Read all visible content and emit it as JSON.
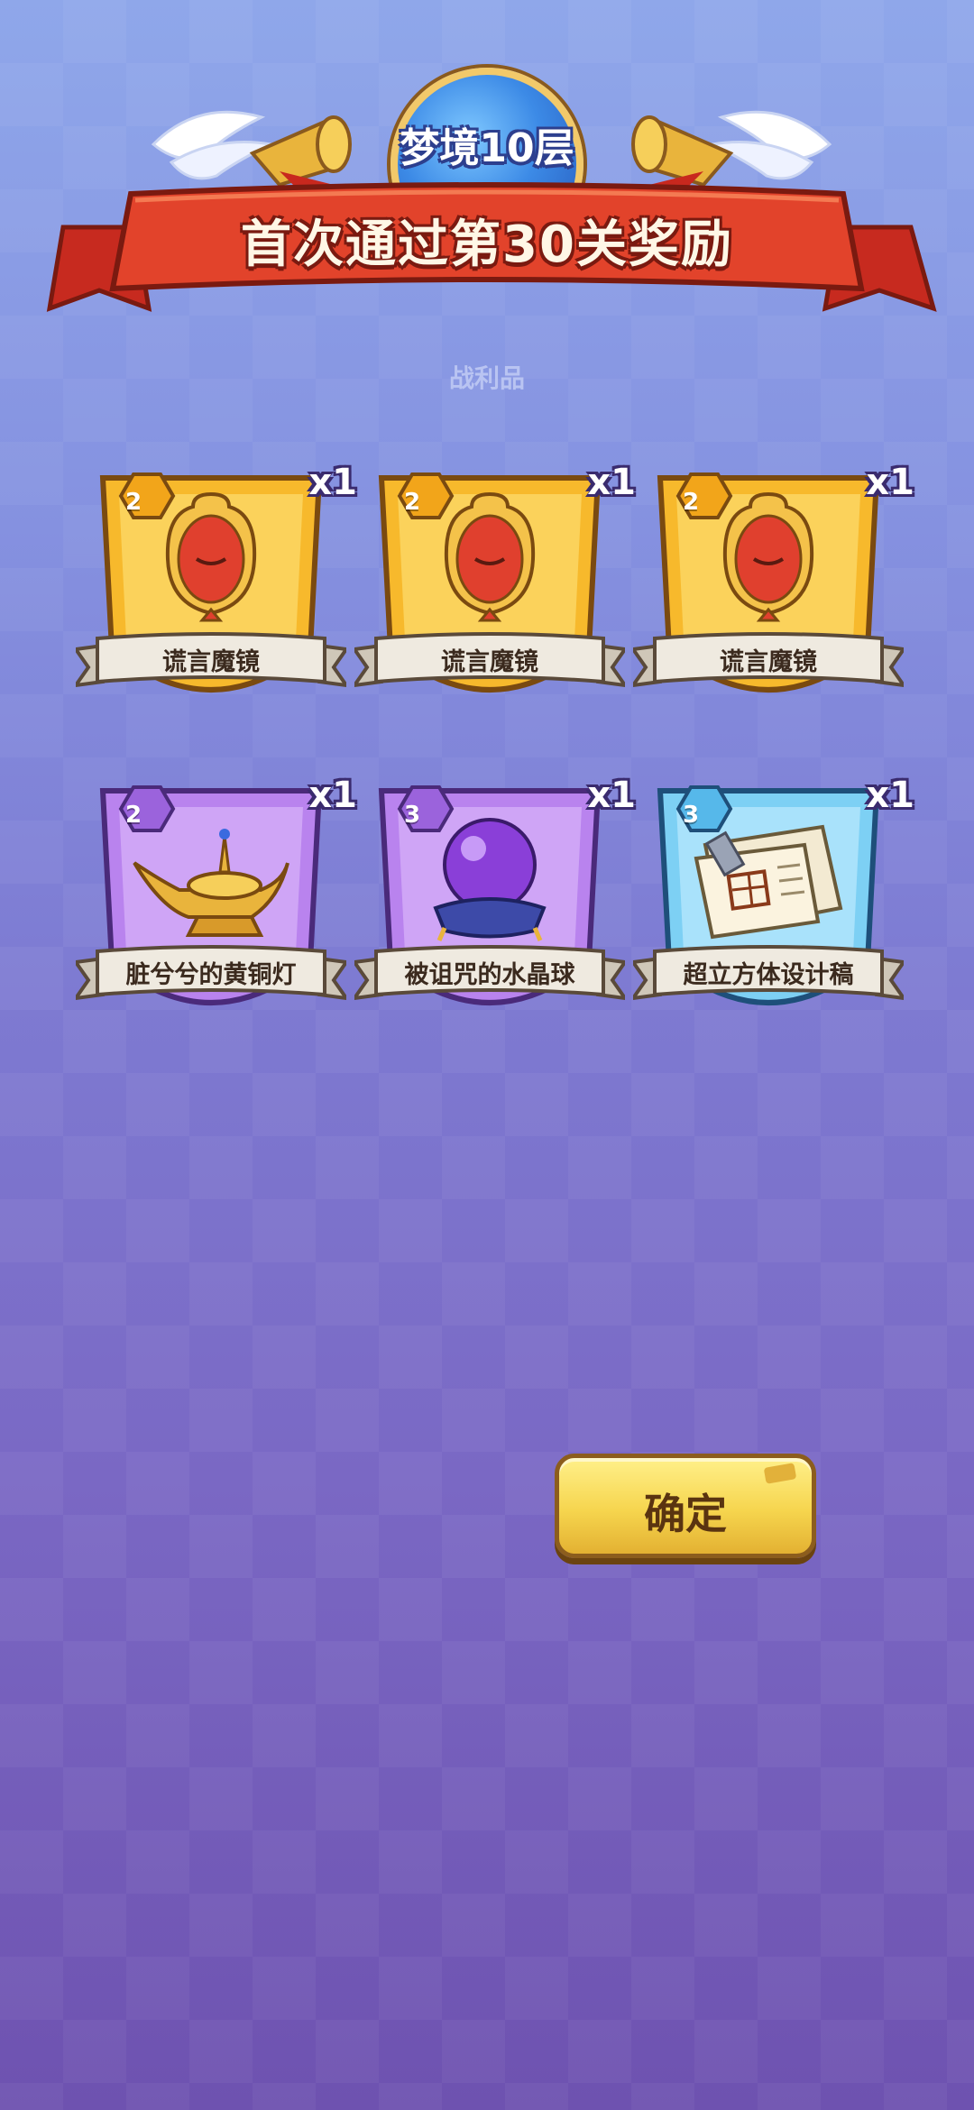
{
  "header": {
    "floor_badge": "梦境10层",
    "title": "首次通过第30关奖励"
  },
  "loot_label": "战利品",
  "rewards": [
    {
      "name": "谎言魔镜",
      "quantity": "x1",
      "level": "2",
      "rarity": "gold",
      "icon": "magic-mirror-icon"
    },
    {
      "name": "谎言魔镜",
      "quantity": "x1",
      "level": "2",
      "rarity": "gold",
      "icon": "magic-mirror-icon"
    },
    {
      "name": "谎言魔镜",
      "quantity": "x1",
      "level": "2",
      "rarity": "gold",
      "icon": "magic-mirror-icon"
    },
    {
      "name": "脏兮兮的黄铜灯",
      "quantity": "x1",
      "level": "2",
      "rarity": "purple",
      "icon": "brass-lamp-icon"
    },
    {
      "name": "被诅咒的水晶球",
      "quantity": "x1",
      "level": "3",
      "rarity": "purple",
      "icon": "crystal-ball-icon"
    },
    {
      "name": "超立方体设计稿",
      "quantity": "x1",
      "level": "3",
      "rarity": "blue",
      "icon": "blueprint-icon"
    }
  ],
  "confirm_label": "确定",
  "colors": {
    "gold_card": "#f7b92c",
    "purple_card": "#b983ee",
    "blue_card": "#7dd0f4",
    "banner_red": "#e2432b",
    "button_yellow": "#f6d54e"
  }
}
